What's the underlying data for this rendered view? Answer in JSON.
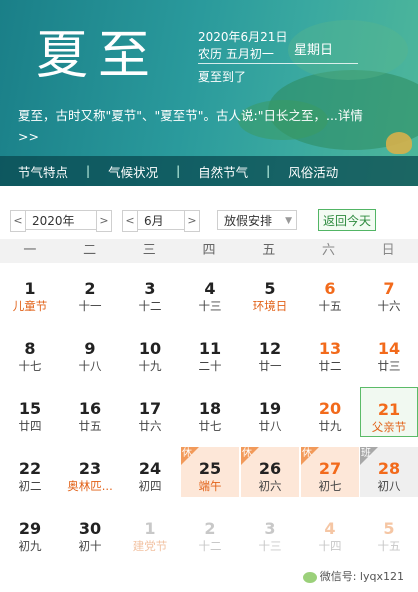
{
  "banner": {
    "title": "夏至",
    "date": "2020年6月21日",
    "lunar": "农历  五月初一",
    "weekday": "星期日",
    "tagline": "夏至到了",
    "intro": "夏至，古时又称\"夏节\"、\"夏至节\"。古人说:\"日长之至，",
    "more": "...详情>>",
    "tabs": [
      "节气特点",
      "气候状况",
      "自然节气",
      "风俗活动"
    ]
  },
  "controls": {
    "prev": "<",
    "next": ">",
    "year": "2020年",
    "month": "6月",
    "holiday": "放假安排",
    "today": "返回今天"
  },
  "weekdays": [
    "一",
    "二",
    "三",
    "四",
    "五",
    "六",
    "日"
  ],
  "weeks": [
    [
      {
        "d": "1",
        "l": "儿童节",
        "fest": true
      },
      {
        "d": "2",
        "l": "十一"
      },
      {
        "d": "3",
        "l": "十二"
      },
      {
        "d": "4",
        "l": "十三"
      },
      {
        "d": "5",
        "l": "环境日",
        "fest": true
      },
      {
        "d": "6",
        "l": "十五",
        "weekend": true
      },
      {
        "d": "7",
        "l": "十六",
        "weekend": true
      }
    ],
    [
      {
        "d": "8",
        "l": "十七"
      },
      {
        "d": "9",
        "l": "十八"
      },
      {
        "d": "10",
        "l": "十九"
      },
      {
        "d": "11",
        "l": "二十"
      },
      {
        "d": "12",
        "l": "廿一"
      },
      {
        "d": "13",
        "l": "廿二",
        "weekend": true
      },
      {
        "d": "14",
        "l": "廿三",
        "weekend": true
      }
    ],
    [
      {
        "d": "15",
        "l": "廿四"
      },
      {
        "d": "16",
        "l": "廿五"
      },
      {
        "d": "17",
        "l": "廿六"
      },
      {
        "d": "18",
        "l": "廿七"
      },
      {
        "d": "19",
        "l": "廿八"
      },
      {
        "d": "20",
        "l": "廿九",
        "weekend": true
      },
      {
        "d": "21",
        "l": "父亲节",
        "weekend": true,
        "fest": true,
        "today": true
      }
    ],
    [
      {
        "d": "22",
        "l": "初二"
      },
      {
        "d": "23",
        "l": "奥林匹...",
        "fest": true
      },
      {
        "d": "24",
        "l": "初四"
      },
      {
        "d": "25",
        "l": "端午",
        "fest": true,
        "holiday": true,
        "badge": "休"
      },
      {
        "d": "26",
        "l": "初六",
        "holiday": true,
        "badge": "休"
      },
      {
        "d": "27",
        "l": "初七",
        "weekend": true,
        "holiday": true,
        "badge": "休"
      },
      {
        "d": "28",
        "l": "初八",
        "weekend": true,
        "workday": true,
        "badge": "班"
      }
    ],
    [
      {
        "d": "29",
        "l": "初九"
      },
      {
        "d": "30",
        "l": "初十"
      },
      {
        "d": "1",
        "l": "建党节",
        "fest": true,
        "other": true
      },
      {
        "d": "2",
        "l": "十二",
        "other": true
      },
      {
        "d": "3",
        "l": "十三",
        "other": true
      },
      {
        "d": "4",
        "l": "十四",
        "weekend": true,
        "other": true
      },
      {
        "d": "5",
        "l": "十五",
        "weekend": true,
        "other": true
      }
    ]
  ],
  "watermark": "微信号: lyqx121"
}
